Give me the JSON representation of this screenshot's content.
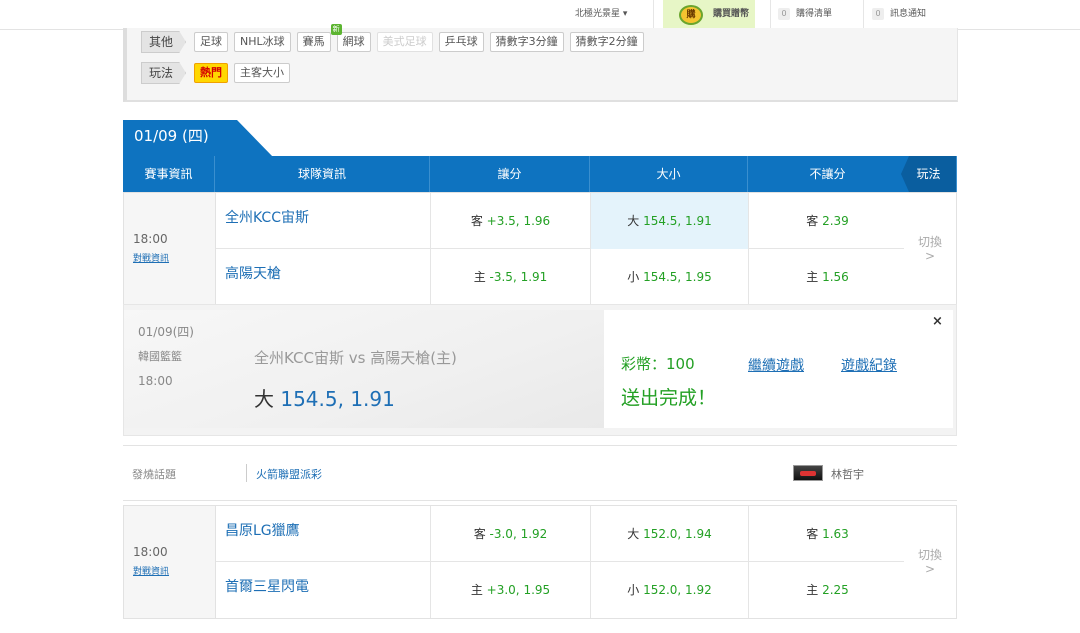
{
  "topbar": {
    "star_label": "北極光景星 ▾",
    "buy_coin_icon_text": "購",
    "buy_label": "購買贈幣",
    "cart_count": "0",
    "cart_label": "購得清單",
    "msg_count": "0",
    "msg_label": "訊息通知"
  },
  "filters": {
    "row1_head": "其他",
    "row1_chips": [
      "足球",
      "NHL冰球",
      "賽馬",
      "網球",
      "美式足球",
      "乒乓球",
      "猜數字3分鐘",
      "猜數字2分鐘"
    ],
    "new_badge": "新",
    "row2_head": "玩法",
    "row2_chips": [
      "熱門",
      "主客大小"
    ]
  },
  "date_tab": "01/09 (四)",
  "table_header": {
    "event": "賽事資訊",
    "team": "球隊資訊",
    "spread": "讓分",
    "total": "大小",
    "moneyline": "不讓分",
    "play": "玩法"
  },
  "games": [
    {
      "time": "18:00",
      "info_link": "對戰資訊",
      "away": {
        "team": "全州KCC宙斯",
        "spread_side": "客",
        "spread_odds": "+3.5, 1.96",
        "total_side": "大",
        "total_odds": "154.5, 1.91",
        "ml_side": "客",
        "ml_odds": "2.39"
      },
      "home": {
        "team": "高陽天槍",
        "spread_side": "主",
        "spread_odds": "-3.5, 1.91",
        "total_side": "小",
        "total_odds": "154.5, 1.95",
        "ml_side": "主",
        "ml_odds": "1.56"
      },
      "switch_label": "切換",
      "switch_arrow": ">"
    },
    {
      "time": "18:00",
      "info_link": "對戰資訊",
      "away": {
        "team": "昌原LG獵鷹",
        "spread_side": "客",
        "spread_odds": "-3.0, 1.92",
        "total_side": "大",
        "total_odds": "152.0, 1.94",
        "ml_side": "客",
        "ml_odds": "1.63"
      },
      "home": {
        "team": "首爾三星閃電",
        "spread_side": "主",
        "spread_odds": "+3.0, 1.95",
        "total_side": "小",
        "total_odds": "152.0, 1.92",
        "ml_side": "主",
        "ml_odds": "2.25"
      },
      "switch_label": "切換",
      "switch_arrow": ">"
    }
  ],
  "confirmation": {
    "date": "01/09(四)",
    "league": "韓國籃籃",
    "time": "18:00",
    "match": "全州KCC宙斯  vs  高陽天槍(主)",
    "bet_side": "大",
    "bet_odds": "154.5, 1.91",
    "credit": "彩幣：100",
    "status": "送出完成！",
    "continue_link": "繼續遊戲",
    "history_link": "遊戲紀錄",
    "close": "×"
  },
  "topic": {
    "label": "發燒話題",
    "title": "火箭聯盟派彩",
    "user": "林哲宇"
  },
  "colors": {
    "header_blue": "#0e73c0",
    "odds_green": "#23a024",
    "link_blue": "#1e6fb5",
    "hot_yellow": "#ffd700"
  }
}
